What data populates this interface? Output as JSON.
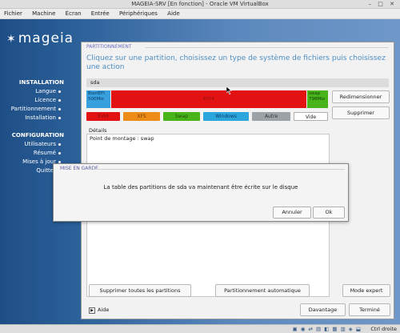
{
  "window": {
    "title": "MAGEIA-SRV [En fonction] - Oracle VM VirtualBox",
    "controls": "– □ ✕"
  },
  "host_menu": [
    "Fichier",
    "Machine",
    "Écran",
    "Entrée",
    "Périphériques",
    "Aide"
  ],
  "logo": {
    "text": "mageia",
    "icon": "mageia-star-icon"
  },
  "sidebar": {
    "installation_title": "INSTALLATION",
    "installation_steps": [
      "Langue",
      "Licence",
      "Partitionnement",
      "Installation"
    ],
    "configuration_title": "CONFIGURATION",
    "configuration_steps": [
      "Utilisateurs",
      "Résumé",
      "Mises à jour",
      "Quitter"
    ]
  },
  "installer": {
    "section_title": "PARTITIONNEMENT",
    "instruction": "Cliquez sur une partition, choisissez un type de système de fichiers puis choisissez une action",
    "drive_tab": "sda",
    "partitions": [
      {
        "name": "BootEFI",
        "size": "500Mio",
        "color": "#38a0dc"
      },
      {
        "name": "EXT4",
        "size": "",
        "color": "#e31212"
      },
      {
        "name": "swap",
        "size": "798Mio",
        "color": "#48b41a"
      }
    ],
    "legend": [
      {
        "label": "Ext4",
        "color": "#e31212",
        "text_color": "#7a1010"
      },
      {
        "label": "XFS",
        "color": "#ee8c1a",
        "text_color": "#6b3a05"
      },
      {
        "label": "Swap",
        "color": "#48b41a",
        "text_color": "#1b4a0a"
      },
      {
        "label": "Windows",
        "color": "#2aa6dc",
        "text_color": "#0b3a63"
      },
      {
        "label": "Autre",
        "color": "#9ba3a9",
        "text_color": "#333333"
      },
      {
        "label": "Vide",
        "color": "#ffffff",
        "text_color": "#222222"
      }
    ],
    "buttons": {
      "resize": "Redimensionner",
      "delete": "Supprimer",
      "delete_all": "Supprimer toutes les partitions",
      "auto": "Partitionnement automatique",
      "expert": "Mode expert",
      "more": "Davantage",
      "done": "Terminé"
    },
    "details_label": "Détails",
    "details_text": "Point de montage : swap",
    "help": "Aide"
  },
  "dialog": {
    "title": "MISE EN GARDE",
    "message": "La table des partitions de sda va maintenant être écrite sur le disque",
    "cancel": "Annuler",
    "ok": "Ok"
  },
  "statusbar": {
    "host_key": "Ctrl droite",
    "icons": "storage-network-usb-display-icons"
  }
}
